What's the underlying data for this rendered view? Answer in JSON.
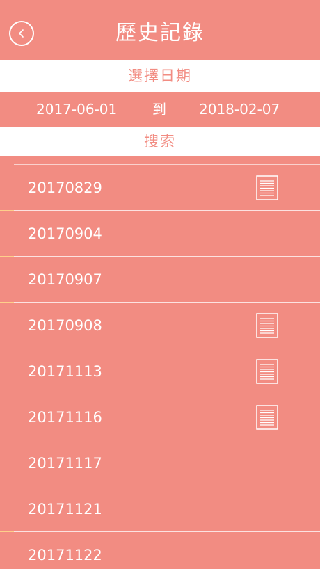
{
  "header": {
    "title": "歷史記錄",
    "back_icon": "chevron-left-icon"
  },
  "date_filter": {
    "label": "選擇日期",
    "start_date": "2017-06-01",
    "to_label": "到",
    "end_date": "2018-02-07"
  },
  "search": {
    "label": "搜索"
  },
  "records": [
    {
      "date": "20170829",
      "has_doc": true
    },
    {
      "date": "20170904",
      "has_doc": false
    },
    {
      "date": "20170907",
      "has_doc": false
    },
    {
      "date": "20170908",
      "has_doc": true
    },
    {
      "date": "20171113",
      "has_doc": true
    },
    {
      "date": "20171116",
      "has_doc": true
    },
    {
      "date": "20171117",
      "has_doc": false
    },
    {
      "date": "20171121",
      "has_doc": false
    },
    {
      "date": "20171122",
      "has_doc": false
    }
  ],
  "colors": {
    "primary": "#f28c82",
    "white": "#ffffff"
  }
}
